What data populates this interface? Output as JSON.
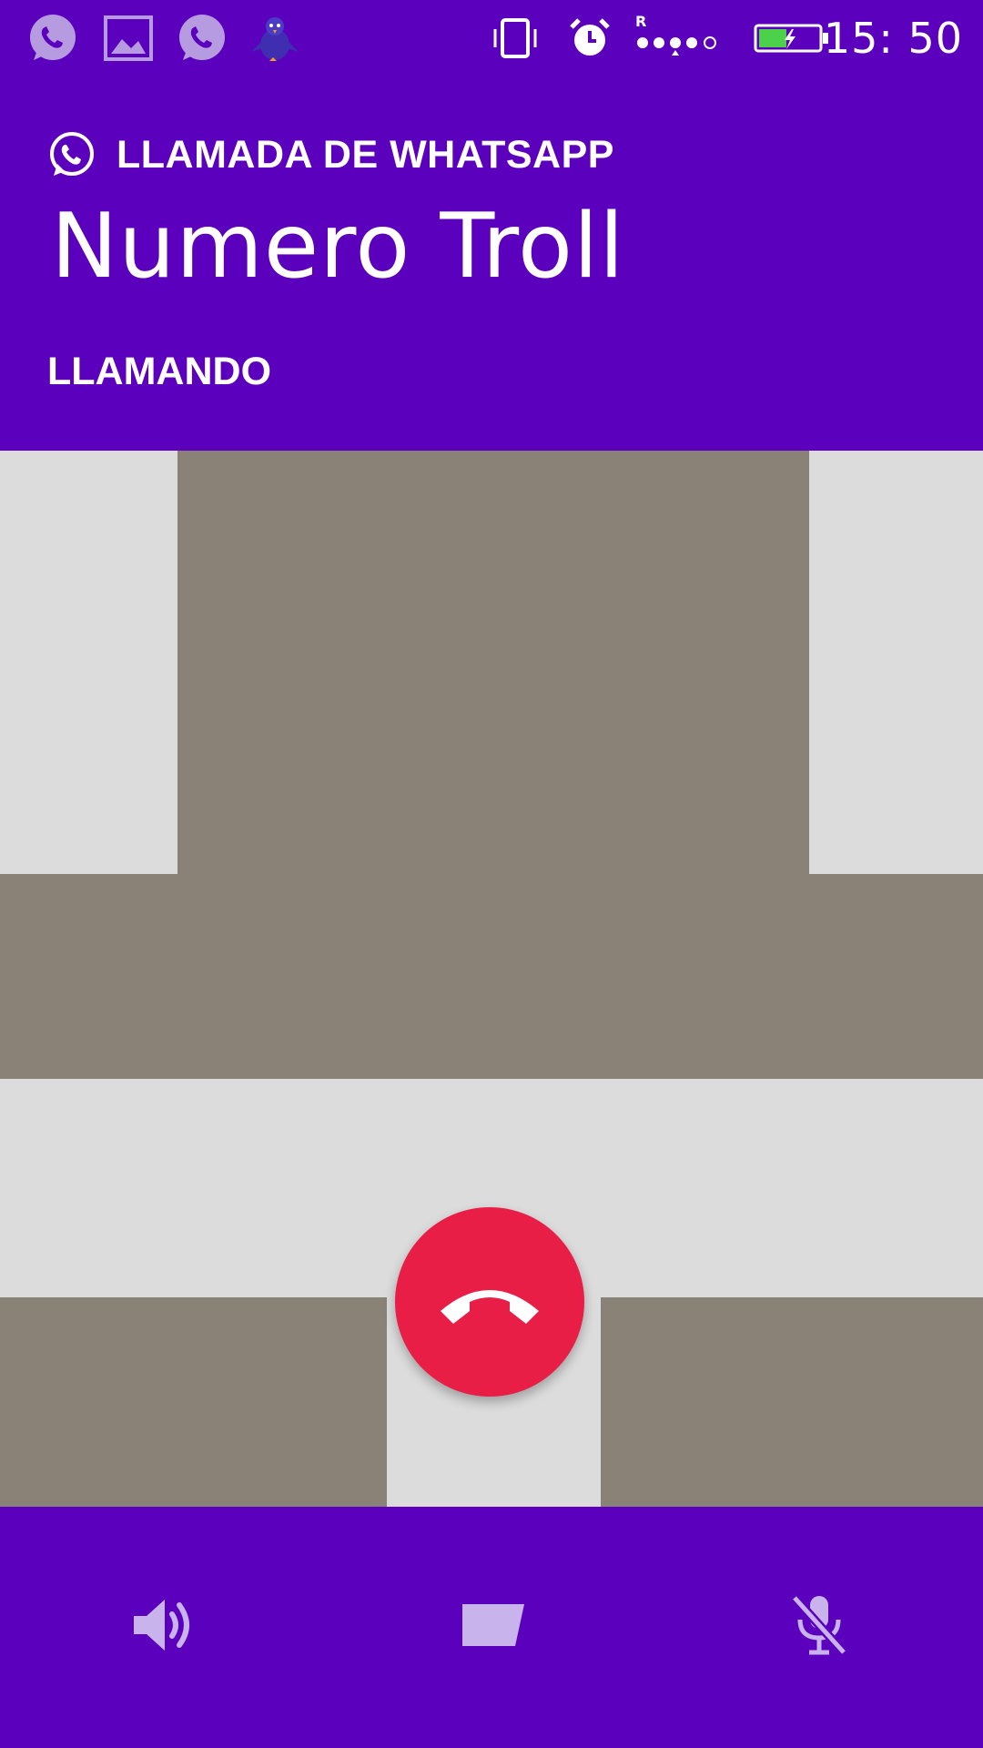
{
  "status_bar": {
    "time": "15: 50",
    "notification_icons": [
      "whatsapp-icon",
      "image-icon",
      "whatsapp-icon",
      "bird-app-icon"
    ],
    "system_icons": [
      "vibrate-icon",
      "alarm-icon",
      "signal-icon",
      "battery-charging-icon"
    ],
    "signal_indicator": "R"
  },
  "call": {
    "label": "LLAMADA DE WHATSAPP",
    "contact_name": "Numero Troll",
    "status": "LLAMANDO"
  },
  "controls": {
    "end_call_icon": "phone-hangup-icon",
    "buttons": [
      {
        "icon": "speaker-icon"
      },
      {
        "icon": "message-icon"
      },
      {
        "icon": "mic-off-icon"
      }
    ]
  },
  "colors": {
    "primary": "#5b00bd",
    "end_call": "#e91e47",
    "icon_tint": "#c9b3ec",
    "wallpaper_light": "#dcdcdc",
    "wallpaper_dark": "#8a8276"
  }
}
